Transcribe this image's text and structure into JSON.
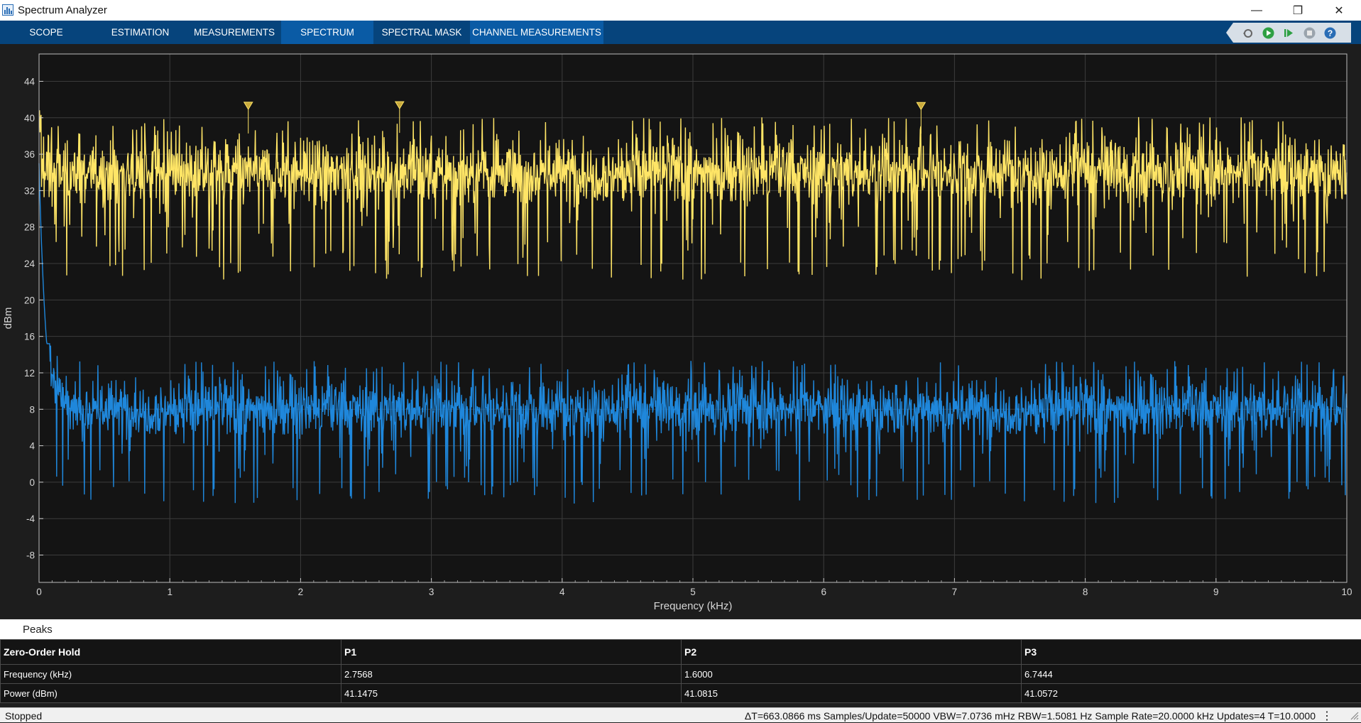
{
  "window": {
    "title": "Spectrum Analyzer",
    "controls": [
      "—",
      "❐",
      "✕"
    ]
  },
  "tabs": [
    {
      "label": "SCOPE",
      "active": false
    },
    {
      "label": "ESTIMATION",
      "active": false
    },
    {
      "label": "MEASUREMENTS",
      "active": false
    },
    {
      "label": "SPECTRUM",
      "active": true
    },
    {
      "label": "SPECTRAL MASK",
      "active": false
    },
    {
      "label": "CHANNEL MEASUREMENTS",
      "active": true
    }
  ],
  "toolbar_icons": [
    "snapshot-icon",
    "run-icon",
    "step-forward-icon",
    "stop-icon",
    "help-icon"
  ],
  "colors": {
    "trace_yellow": "#ffe566",
    "trace_blue": "#1f87db",
    "plot_bg": "#141414",
    "grid": "#3c3c3c",
    "toolstrip": "#06447c",
    "active_tab": "#0a5ba5"
  },
  "chart_data": {
    "type": "line",
    "xlabel": "Frequency (kHz)",
    "ylabel": "dBm",
    "xlim": [
      0,
      10
    ],
    "ylim": [
      -11,
      47
    ],
    "xticks": [
      0,
      1,
      2,
      3,
      4,
      5,
      6,
      7,
      8,
      9,
      10
    ],
    "yticks": [
      -8,
      -4,
      0,
      4,
      8,
      12,
      16,
      20,
      24,
      28,
      32,
      36,
      40,
      44
    ],
    "grid": true,
    "series": [
      {
        "color": "#ffe566",
        "baseline": 34,
        "spread": 3.2,
        "typical_max": 40,
        "typical_min": 26,
        "start_value": 39
      },
      {
        "color": "#1f87db",
        "baseline": 8,
        "spread": 2.8,
        "typical_max": 14,
        "typical_min": 0,
        "start_value": 38,
        "decay_to": 0.12
      }
    ],
    "peak_markers": [
      {
        "label": "P1",
        "x": 2.7568,
        "y": 41.1475
      },
      {
        "label": "P2",
        "x": 1.6,
        "y": 41.0815
      },
      {
        "label": "P3",
        "x": 6.7444,
        "y": 41.0572
      }
    ]
  },
  "panel": {
    "title": "Peaks",
    "table": {
      "headers": [
        "Zero-Order Hold",
        "P1",
        "P2",
        "P3"
      ],
      "rows": [
        [
          "Frequency (kHz)",
          "2.7568",
          "1.6000",
          "6.7444"
        ],
        [
          "Power (dBm)",
          "41.1475",
          "41.0815",
          "41.0572"
        ]
      ]
    }
  },
  "status": {
    "state": "Stopped",
    "info": "ΔT=663.0866 ms  Samples/Update=50000  VBW=7.0736 mHz  RBW=1.5081 Hz  Sample Rate=20.0000 kHz  Updates=4  T=10.0000"
  }
}
